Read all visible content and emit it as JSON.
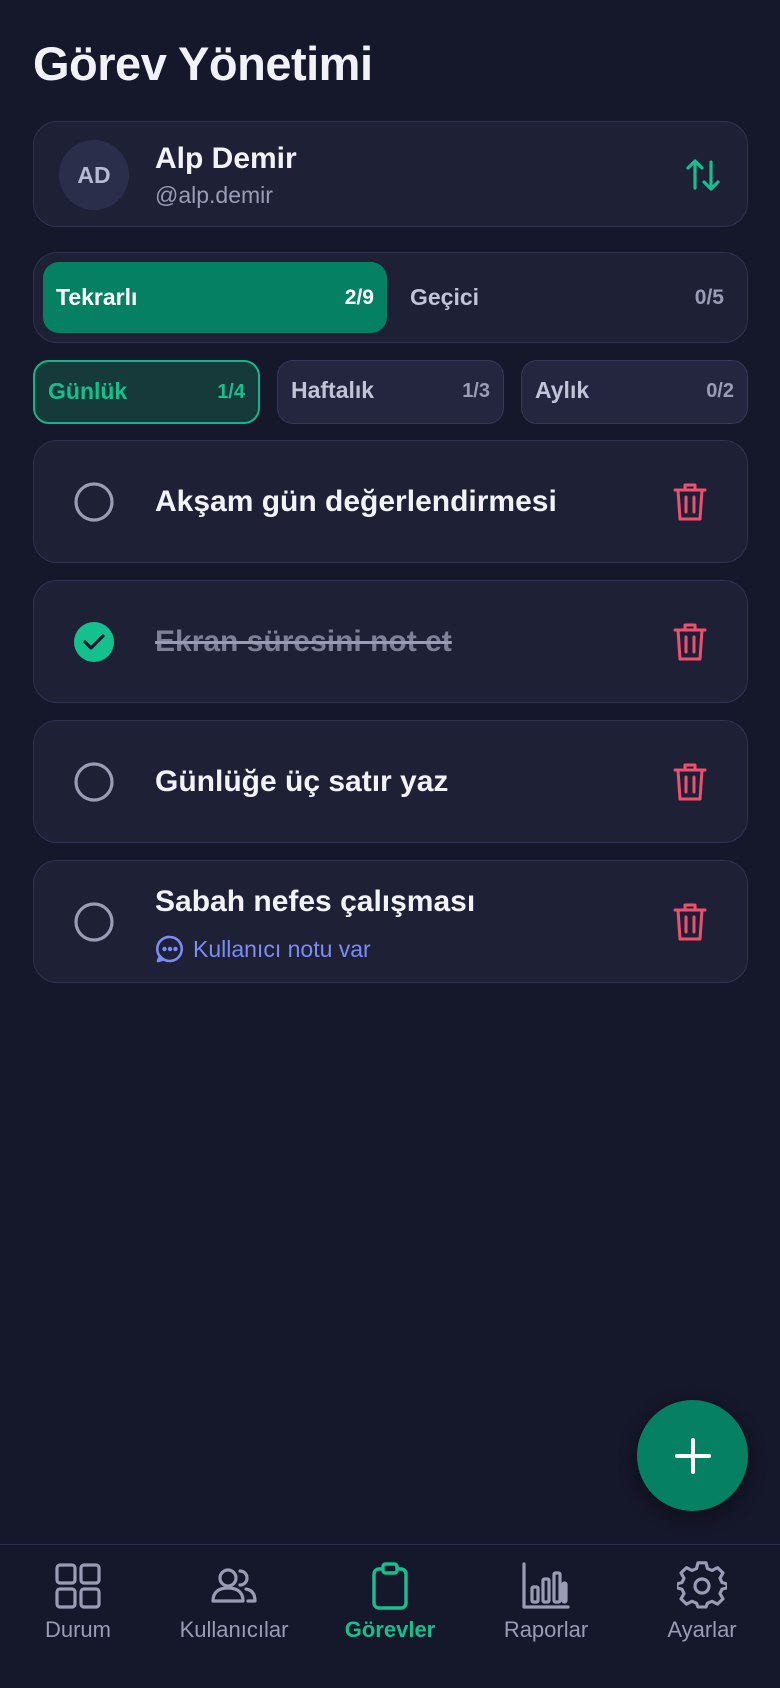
{
  "header": {
    "title": "Görev Yönetimi"
  },
  "user": {
    "initials": "AD",
    "name": "Alp Demir",
    "handle": "@alp.demir"
  },
  "segments": [
    {
      "label": "Tekrarlı",
      "count": "2/9",
      "active": true
    },
    {
      "label": "Geçici",
      "count": "0/5",
      "active": false
    }
  ],
  "periods": [
    {
      "label": "Günlük",
      "count": "1/4",
      "active": true
    },
    {
      "label": "Haftalık",
      "count": "1/3",
      "active": false
    },
    {
      "label": "Aylık",
      "count": "0/2",
      "active": false
    }
  ],
  "tasks": [
    {
      "title": "Akşam gün değerlendirmesi",
      "done": false
    },
    {
      "title": "Ekran süresini not et",
      "done": true
    },
    {
      "title": "Günlüğe üç satır yaz",
      "done": false
    },
    {
      "title": "Sabah nefes çalışması",
      "done": false,
      "note": "Kullanıcı notu var"
    }
  ],
  "nav": [
    {
      "label": "Durum",
      "icon": "grid-icon",
      "active": false
    },
    {
      "label": "Kullanıcılar",
      "icon": "users-icon",
      "active": false
    },
    {
      "label": "Görevler",
      "icon": "clipboard-icon",
      "active": true
    },
    {
      "label": "Raporlar",
      "icon": "bar-chart-icon",
      "active": false
    },
    {
      "label": "Ayarlar",
      "icon": "gear-icon",
      "active": false
    }
  ],
  "colors": {
    "background": "#15172a",
    "card": "#1e2035",
    "accent": "#068062",
    "accent_bright": "#14c08e",
    "danger": "#f0506e",
    "note": "#7b8cf5"
  }
}
